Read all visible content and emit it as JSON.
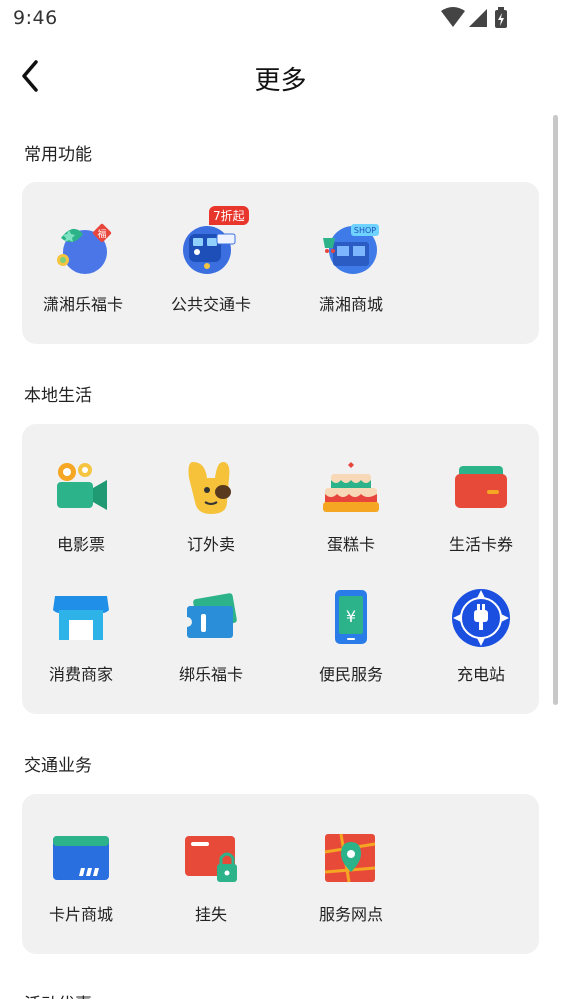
{
  "status_bar": {
    "time": "9:46"
  },
  "header": {
    "title": "更多"
  },
  "sections": [
    {
      "title": "常用功能",
      "items": [
        {
          "label": "潇湘乐福卡",
          "icon": "lefu-card-icon"
        },
        {
          "label": "公共交通卡",
          "icon": "transit-card-icon",
          "badge": "7折起"
        },
        {
          "label": "潇湘商城",
          "icon": "shop-icon"
        }
      ]
    },
    {
      "title": "本地生活",
      "items": [
        {
          "label": "电影票",
          "icon": "movie-camera-icon"
        },
        {
          "label": "订外卖",
          "icon": "takeout-mascot-icon"
        },
        {
          "label": "蛋糕卡",
          "icon": "cake-icon"
        },
        {
          "label": "生活卡券",
          "icon": "wallet-icon"
        },
        {
          "label": "消费商家",
          "icon": "storefront-icon"
        },
        {
          "label": "绑乐福卡",
          "icon": "bind-card-icon"
        },
        {
          "label": "便民服务",
          "icon": "yuan-phone-icon"
        },
        {
          "label": "充电站",
          "icon": "charging-plug-icon"
        }
      ]
    },
    {
      "title": "交通业务",
      "items": [
        {
          "label": "卡片商城",
          "icon": "card-shop-icon"
        },
        {
          "label": "挂失",
          "icon": "card-lock-icon"
        },
        {
          "label": "服务网点",
          "icon": "map-pin-icon"
        }
      ]
    },
    {
      "title": "活动优惠"
    }
  ]
}
